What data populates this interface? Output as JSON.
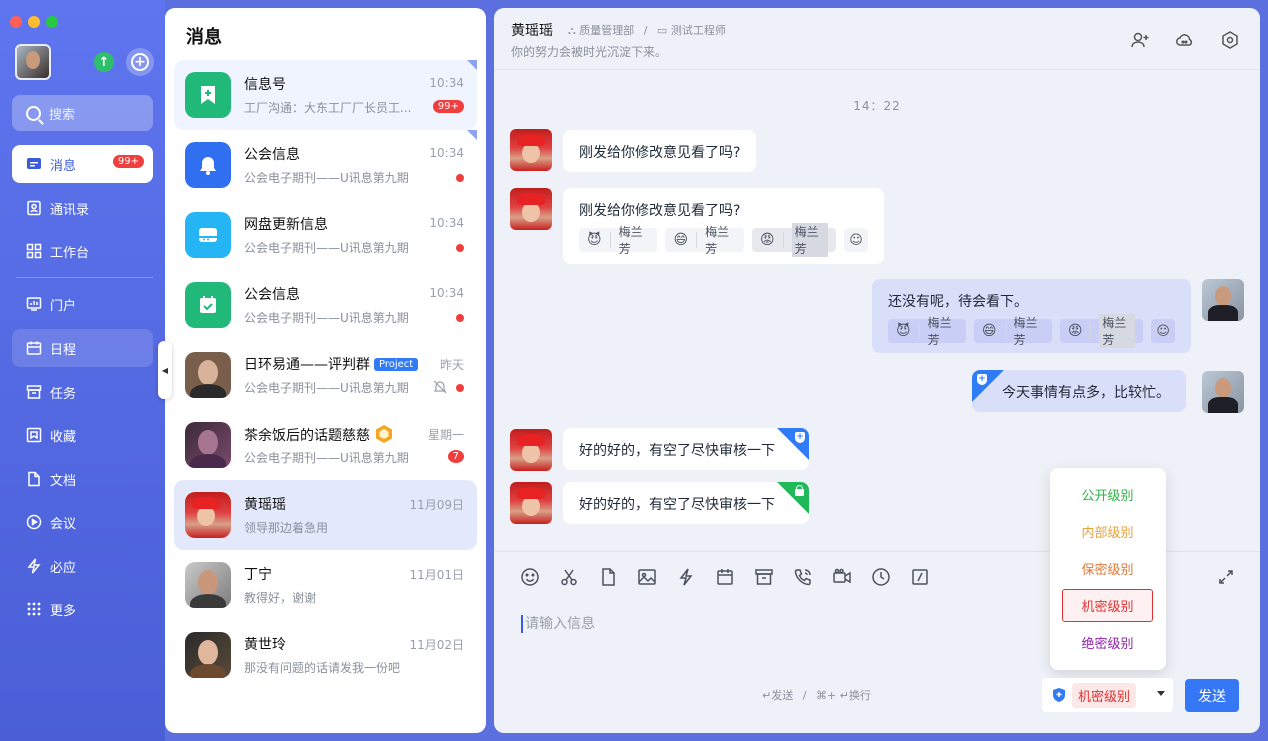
{
  "window": {
    "traffic_lights": [
      "#ff5f57",
      "#febc2e",
      "#28c840"
    ]
  },
  "sidebar": {
    "search_label": "搜索",
    "items": [
      {
        "label": "消息",
        "badge": "99+",
        "icon": "message-icon"
      },
      {
        "label": "通讯录",
        "icon": "contacts-icon"
      },
      {
        "label": "工作台",
        "icon": "workbench-icon"
      },
      {
        "label": "门户",
        "icon": "portal-icon"
      },
      {
        "label": "日程",
        "icon": "calendar-icon"
      },
      {
        "label": "任务",
        "icon": "task-icon"
      },
      {
        "label": "收藏",
        "icon": "favorite-icon"
      },
      {
        "label": "文档",
        "icon": "document-icon"
      },
      {
        "label": "会议",
        "icon": "meeting-icon"
      },
      {
        "label": "必应",
        "icon": "lightning-icon"
      },
      {
        "label": "更多",
        "icon": "more-grid-icon"
      }
    ]
  },
  "conversations": {
    "title": "消息",
    "items": [
      {
        "name": "信息号",
        "preview": "工厂沟通：大东工厂厂长员工...",
        "time": "10:34",
        "badge": "99+",
        "icon_color": "#20b97a"
      },
      {
        "name": "公会信息",
        "preview": "公会电子期刊——U讯息第九期",
        "time": "10:34",
        "icon_color": "#2f6ff0"
      },
      {
        "name": "网盘更新信息",
        "preview": "公会电子期刊——U讯息第九期",
        "time": "10:34",
        "icon_color": "#25b5f5"
      },
      {
        "name": "公会信息",
        "preview": "公会电子期刊——U讯息第九期",
        "time": "10:34",
        "icon_color": "#20b97a"
      },
      {
        "name": "日环易通——评判群",
        "tag": "Project",
        "preview": "公会电子期刊——U讯息第九期",
        "time": "昨天"
      },
      {
        "name": "茶余饭后的话题慈慈",
        "preview": "公会电子期刊——U讯息第九期",
        "time": "星期一",
        "badge": "7"
      },
      {
        "name": "黄瑶瑶",
        "preview": "领导那边着急用",
        "time": "11月09日"
      },
      {
        "name": "丁宁",
        "preview": "教得好，谢谢",
        "time": "11月01日"
      },
      {
        "name": "黄世玲",
        "preview": "那没有问题的话请发我一份吧",
        "time": "11月02日"
      }
    ]
  },
  "chat": {
    "contact_name": "黄瑶瑶",
    "department": "质量管理部",
    "separator": "/",
    "role": "测试工程师",
    "signature": "你的努力会被时光沉淀下来。",
    "timestamp": "14：22",
    "messages": [
      {
        "from": "them",
        "text": "刚发给你修改意见看了吗?"
      },
      {
        "from": "them",
        "text": "刚发给你修改意见看了吗?",
        "reactions": [
          {
            "emoji": "😈",
            "name": "梅兰芳"
          },
          {
            "emoji": "😄",
            "name": "梅兰芳"
          },
          {
            "emoji": "😡",
            "name": "梅兰芳"
          }
        ]
      },
      {
        "from": "me",
        "text": "还没有呢，待会看下。",
        "reactions": [
          {
            "emoji": "😈",
            "name": "梅兰芳"
          },
          {
            "emoji": "😄",
            "name": "梅兰芳"
          },
          {
            "emoji": "😡",
            "name": "梅兰芳"
          }
        ]
      },
      {
        "from": "me",
        "text": "今天事情有点多，比较忙。",
        "secure": "blue"
      },
      {
        "from": "them",
        "text": "好的好的，有空了尽快审核一下",
        "secure": "blue"
      },
      {
        "from": "them",
        "text": "好的好的，有空了尽快审核一下",
        "secure": "green"
      }
    ],
    "composer": {
      "placeholder": "请输入信息",
      "send_hint": "↵发送",
      "hint_separator": "/",
      "newline_hint": "⌘+ ↵换行",
      "selected_level": "机密级别",
      "send_label": "发送"
    },
    "security_levels": [
      {
        "label": "公开级别",
        "color": "#2fb344"
      },
      {
        "label": "内部级别",
        "color": "#e8a23a"
      },
      {
        "label": "保密级别",
        "color": "#e07a3a"
      },
      {
        "label": "机密级别",
        "color": "#e03131"
      },
      {
        "label": "绝密级别",
        "color": "#8e24aa"
      }
    ]
  }
}
